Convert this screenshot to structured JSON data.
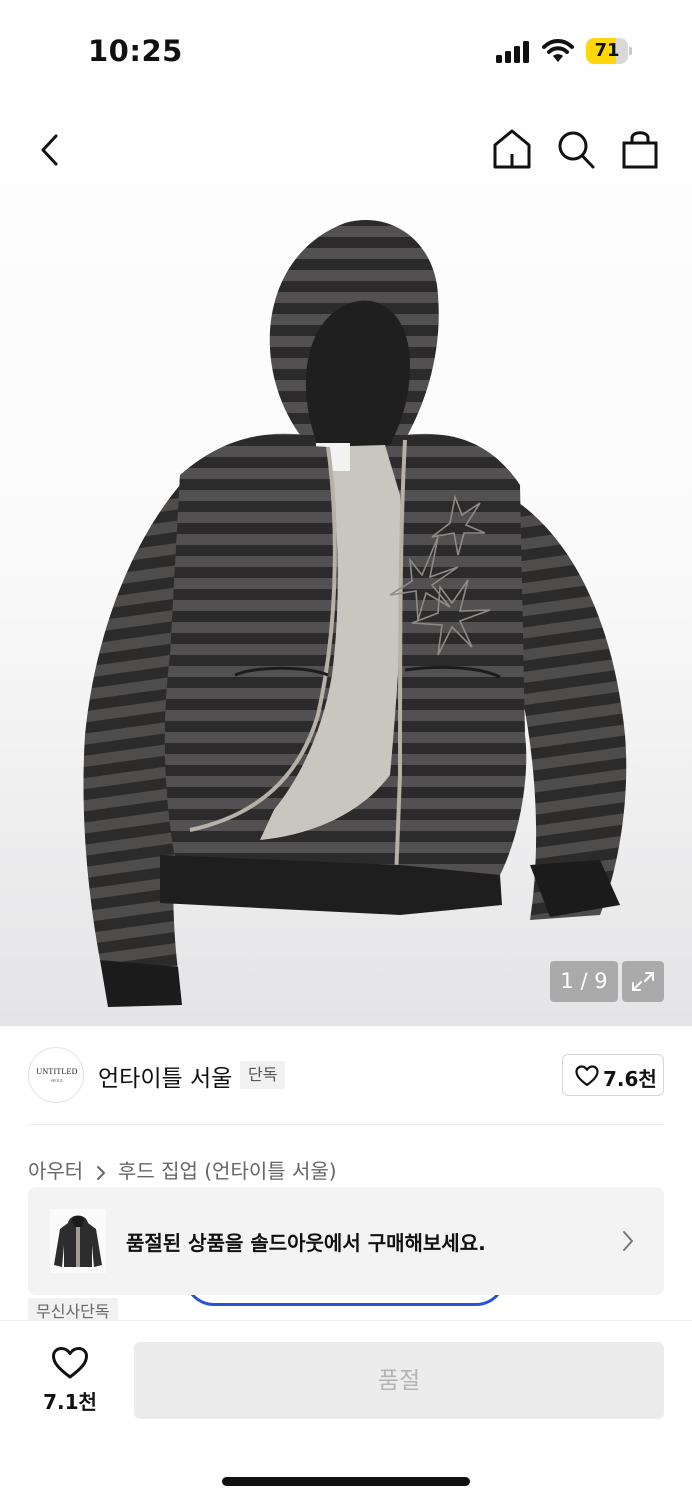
{
  "status_bar": {
    "time": "10:25",
    "battery_level": "71",
    "battery_fraction": 0.71,
    "battery_color": "#ffd60a",
    "icons": [
      "signal-icon",
      "wifi-icon",
      "battery-icon"
    ]
  },
  "nav": {
    "icons": [
      "back-chevron-icon",
      "home-icon",
      "search-icon",
      "shopping-bag-icon"
    ]
  },
  "gallery": {
    "counter": "1 / 9",
    "expand_icon": "expand-icon"
  },
  "brand": {
    "logo_text": "UNTITLED",
    "logo_subtext": "SEOUL",
    "name": "언타이틀 서울",
    "badge": "단독",
    "like_count": "7.6천",
    "like_icon": "heart-outline-icon"
  },
  "breadcrumb": {
    "category": "아우터",
    "subcategory": "후드 집업 (언타이틀 서울)"
  },
  "soldout_banner": {
    "text": "품절된 상품을 솔드아웃에서 구매해보세요.",
    "chevron_icon": "chevron-right-icon"
  },
  "tags": {
    "exclusive": "무신사단독"
  },
  "bottom_bar": {
    "wish_count": "7.1천",
    "buy_label": "품절",
    "accent_color": "#2a52d6"
  }
}
